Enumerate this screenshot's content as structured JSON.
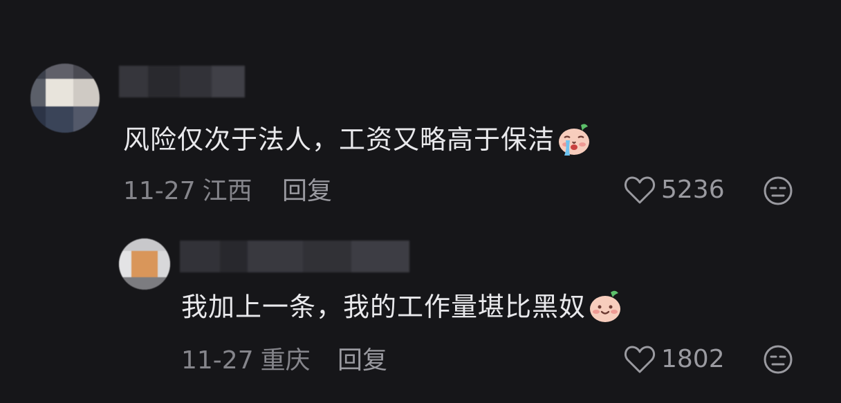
{
  "comments": [
    {
      "text": "风险仅次于法人，工资又略高于保洁",
      "emoji_icon": "crying-face-icon",
      "date": "11-27",
      "region": "江西",
      "reply_label": "回复",
      "like_count": "5236"
    },
    {
      "text": "我加上一条，我的工作量堪比黑奴",
      "emoji_icon": "smiling-face-icon",
      "date": "11-27",
      "region": "重庆",
      "reply_label": "回复",
      "like_count": "1802"
    }
  ],
  "colors": {
    "background": "#161619",
    "text": "#e9e9ec",
    "meta": "#85858b"
  }
}
